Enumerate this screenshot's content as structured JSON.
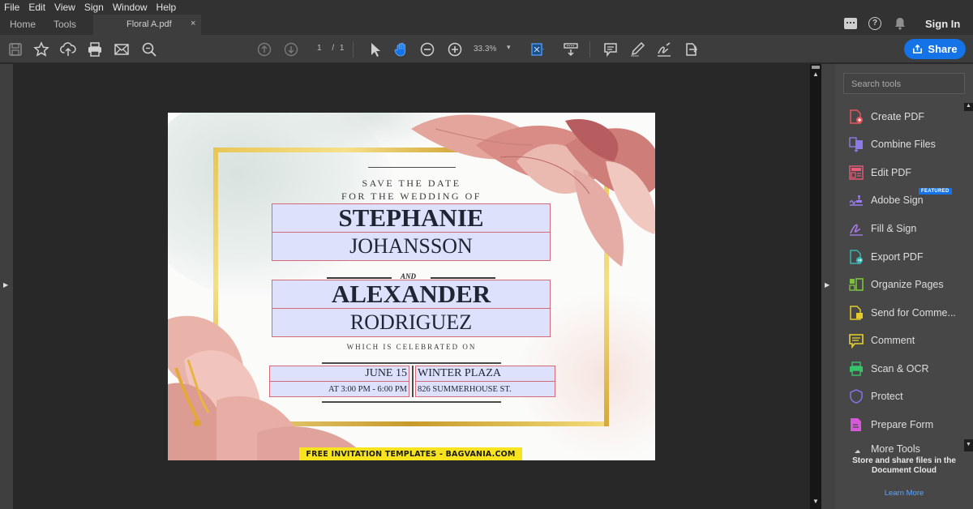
{
  "menu": [
    "File",
    "Edit",
    "View",
    "Sign",
    "Window",
    "Help"
  ],
  "tabs": {
    "home": "Home",
    "tools": "Tools",
    "file": "Floral A.pdf",
    "close": "×"
  },
  "header": {
    "sign_in": "Sign In",
    "share": "Share"
  },
  "toolbar": {
    "page_current": "1",
    "page_total": "/ 1",
    "zoom": "33.3%"
  },
  "panel": {
    "search_placeholder": "Search tools",
    "featured_badge": "FEATURED",
    "tools": [
      {
        "label": "Create PDF",
        "color": "#e8555f"
      },
      {
        "label": "Combine Files",
        "color": "#8a7be8"
      },
      {
        "label": "Edit PDF",
        "color": "#ea5a78"
      },
      {
        "label": "Adobe Sign",
        "color": "#9c7bea"
      },
      {
        "label": "Fill & Sign",
        "color": "#a67de6"
      },
      {
        "label": "Export PDF",
        "color": "#3ab4b0"
      },
      {
        "label": "Organize Pages",
        "color": "#7cc33a"
      },
      {
        "label": "Send for Comme...",
        "color": "#e6cc2a"
      },
      {
        "label": "Comment",
        "color": "#ead32c"
      },
      {
        "label": "Scan & OCR",
        "color": "#36c36a"
      },
      {
        "label": "Protect",
        "color": "#7d74e0"
      },
      {
        "label": "Prepare Form",
        "color": "#d65ad8"
      },
      {
        "label": "More Tools",
        "color": "#cfcfcf"
      }
    ],
    "cloud_text": "Store and share files in the Document Cloud",
    "learn_more": "Learn More"
  },
  "document": {
    "save_the_date": "SAVE THE DATE",
    "for_wedding": "FOR THE WEDDING OF",
    "bride_first": "STEPHANIE",
    "bride_last": "JOHANSSON",
    "and": "AND",
    "groom_first": "ALEXANDER",
    "groom_last": "RODRIGUEZ",
    "celebrated": "WHICH IS CELEBRATED ON",
    "date": "JUNE 15",
    "time": "AT 3:00 PM - 6:00 PM",
    "venue": "WINTER PLAZA",
    "address": "826 SUMMERHOUSE ST.",
    "watermark": "FREE INVITATION TEMPLATES - BAGVANIA.COM"
  }
}
